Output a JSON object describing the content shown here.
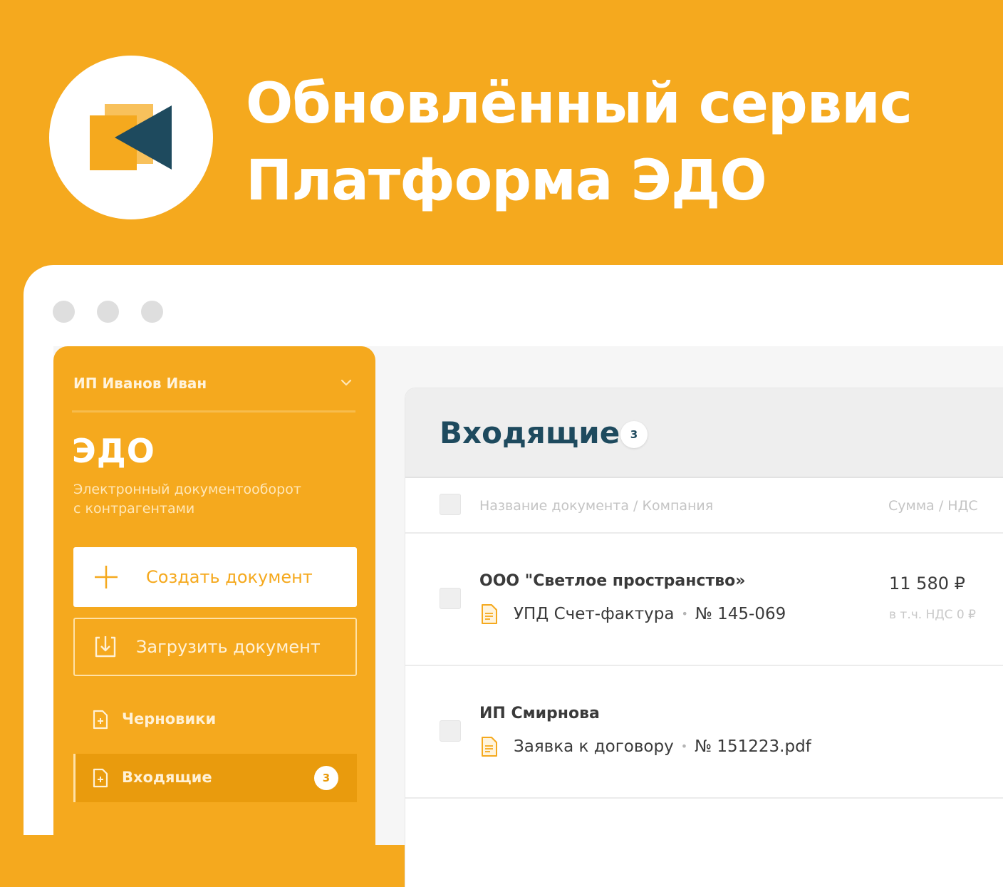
{
  "banner": {
    "title_line1": "Обновлённый сервис",
    "title_line2": "Платформа ЭДО"
  },
  "colors": {
    "background": "#F5A91E",
    "logo_dark": "#1E4A5E",
    "sidebar_active": "#E99B0D",
    "title_text": "#1E4A5E"
  },
  "sidebar": {
    "organization": "ИП Иванов Иван",
    "brand": "ЭДО",
    "description_line1": "Электронный документооборот",
    "description_line2": "с контрагентами",
    "create_button": "Создать документ",
    "upload_button": "Загрузить документ",
    "nav": [
      {
        "label": "Черновики",
        "icon": "document-icon"
      },
      {
        "label": "Входящие",
        "icon": "document-icon",
        "badge": "3",
        "active": true
      }
    ]
  },
  "main": {
    "title": "Входящие",
    "count_badge": "3",
    "table": {
      "columns": [
        "Название документа / Компания",
        "Сумма / НДС"
      ],
      "rows": [
        {
          "company": "ООО \"Светлое пространство»",
          "document": "УПД Счет-фактура",
          "number": "№ 145-069",
          "amount": "11 580 ₽",
          "vat": "в т.ч. НДС 0 ₽"
        },
        {
          "company": "ИП Смирнова",
          "document": "Заявка к договору",
          "number": "№ 151223.pdf",
          "amount": "",
          "vat": ""
        }
      ]
    }
  }
}
